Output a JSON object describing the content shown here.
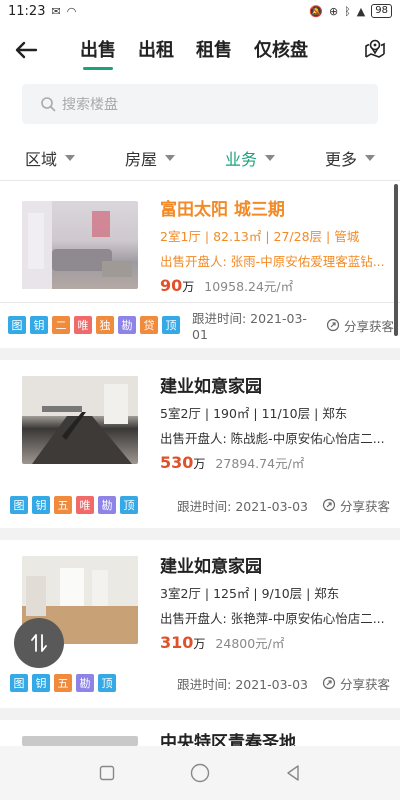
{
  "status_bar": {
    "time": "11:23",
    "battery": "98"
  },
  "header": {
    "tabs": [
      {
        "label": "出售",
        "active": true
      },
      {
        "label": "出租",
        "active": false
      },
      {
        "label": "租售",
        "active": false
      },
      {
        "label": "仅核盘",
        "active": false
      }
    ]
  },
  "search": {
    "placeholder": "搜索楼盘"
  },
  "filters": [
    {
      "label": "区域",
      "active": false
    },
    {
      "label": "房屋",
      "active": false
    },
    {
      "label": "业务",
      "active": true
    },
    {
      "label": "更多",
      "active": false
    }
  ],
  "listings": [
    {
      "title": "富田太阳 城三期",
      "meta": "2室1厅 | 82.13㎡ | 27/28层 | 管城",
      "agent": "出售开盘人: 张雨-中原安佑爱理客蓝钻...",
      "price": "90",
      "price_unit": "万",
      "unit_price": "10958.24元/㎡",
      "tags": [
        "图",
        "钥",
        "二",
        "唯",
        "独",
        "勘",
        "贷",
        "顶"
      ],
      "follow_time": "跟进时间: 2021-03-01",
      "share": "分享获客",
      "highlight": true
    },
    {
      "title": "建业如意家园",
      "meta": "5室2厅 | 190㎡ | 11/10层 | 郑东",
      "agent": "出售开盘人: 陈战彪-中原安佑心怡店二...",
      "price": "530",
      "price_unit": "万",
      "unit_price": "27894.74元/㎡",
      "tags": [
        "图",
        "钥",
        "五",
        "唯",
        "勘",
        "顶"
      ],
      "follow_time": "跟进时间: 2021-03-03",
      "share": "分享获客",
      "highlight": false
    },
    {
      "title": "建业如意家园",
      "meta": "3室2厅 | 125㎡ | 9/10层 | 郑东",
      "agent": "出售开盘人: 张艳萍-中原安佑心怡店二...",
      "price": "310",
      "price_unit": "万",
      "unit_price": "24800元/㎡",
      "tags": [
        "图",
        "钥",
        "五",
        "勘",
        "顶"
      ],
      "follow_time": "跟进时间: 2021-03-03",
      "share": "分享获客",
      "highlight": false
    },
    {
      "title": "中央特区青春圣地",
      "highlight": false
    }
  ],
  "colors": {
    "accent": "#1aa37a",
    "highlight": "#f28b27",
    "price": "#e0502a"
  },
  "icons": [
    "back-arrow-icon",
    "map-pin-icon",
    "search-icon",
    "share-icon",
    "swap-icon",
    "nav-square-icon",
    "nav-circle-icon",
    "nav-back-icon"
  ]
}
